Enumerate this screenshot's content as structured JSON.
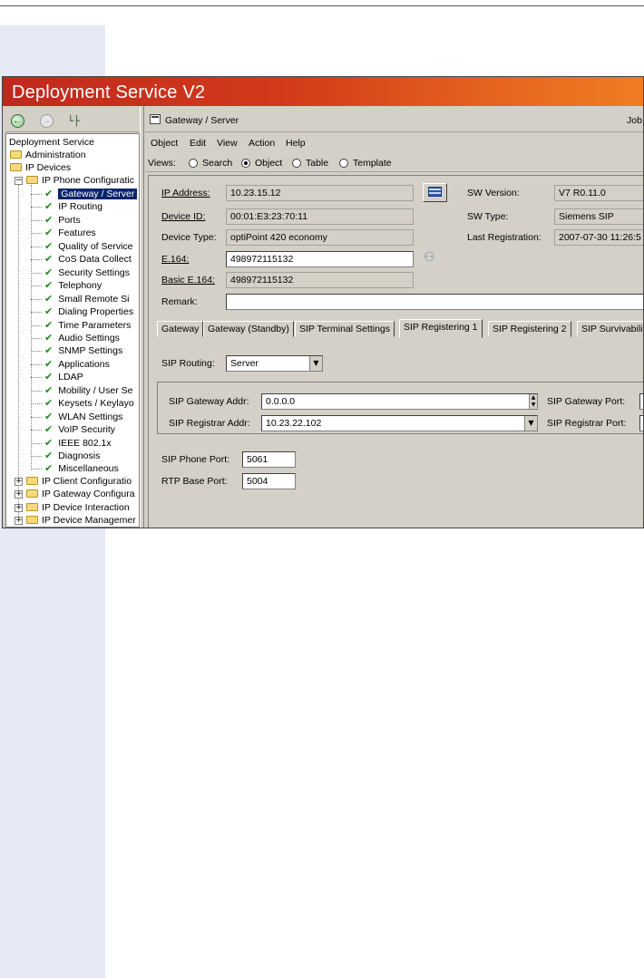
{
  "window": {
    "title": "Deployment Service V2"
  },
  "tree": {
    "root": "Deployment Service",
    "top_folders": [
      "Administration",
      "IP Devices"
    ],
    "phone_config": "IP Phone Configuratic",
    "items": [
      "Gateway / Server",
      "IP Routing",
      "Ports",
      "Features",
      "Quality of Service",
      "CoS Data Collect",
      "Security Settings",
      "Telephony",
      "Small Remote Si",
      "Dialing Properties",
      "Time Parameters",
      "Audio Settings",
      "SNMP Settings",
      "Applications",
      "LDAP",
      "Mobility / User Se",
      "Keysets / Keylayo",
      "WLAN Settings",
      "VoIP Security",
      "IEEE 802.1x",
      "Diagnosis",
      "Miscellaneous"
    ],
    "bottom_folders": [
      "IP Client Configuratio",
      "IP Gateway Configura",
      "IP Device Interaction",
      "IP Device Managemer"
    ]
  },
  "right_header": {
    "title": "Gateway / Server",
    "jobs": "Job"
  },
  "menu": [
    "Object",
    "Edit",
    "View",
    "Action",
    "Help"
  ],
  "views": {
    "label": "Views:",
    "options": [
      "Search",
      "Object",
      "Table",
      "Template"
    ],
    "selected": "Object"
  },
  "form": {
    "ip_address_label": "IP Address:",
    "ip_address": "10.23.15.12",
    "device_id_label": "Device ID:",
    "device_id": "00:01:E3:23:70:11",
    "device_type_label": "Device Type:",
    "device_type": "optiPoint 420 economy",
    "e164_label": "E.164:",
    "e164": "498972115132",
    "basic_e164_label": "Basic E.164:",
    "basic_e164": "498972115132",
    "remark_label": "Remark:",
    "remark": "",
    "sw_version_label": "SW Version:",
    "sw_version": "V7 R0.11.0",
    "sw_type_label": "SW Type:",
    "sw_type": "Siemens SIP",
    "last_reg_label": "Last Registration:",
    "last_reg": "2007-07-30 11:26:5"
  },
  "tabs": [
    "Gateway",
    "Gateway (Standby)",
    "SIP Terminal Settings",
    "SIP Registering 1",
    "SIP Registering 2",
    "SIP Survivabili"
  ],
  "active_tab": "SIP Registering 1",
  "sip": {
    "routing_label": "SIP Routing:",
    "routing": "Server",
    "gateway_addr_label": "SIP Gateway Addr:",
    "gateway_addr": "0.0.0.0",
    "gateway_port_label": "SIP Gateway Port:",
    "gateway_port": "(",
    "registrar_addr_label": "SIP Registrar Addr:",
    "registrar_addr": "10.23.22.102",
    "registrar_port_label": "SIP Registrar Port:",
    "registrar_port": "!",
    "phone_port_label": "SIP Phone Port:",
    "phone_port": "5061",
    "rtp_base_label": "RTP Base Port:",
    "rtp_base": "5004"
  }
}
